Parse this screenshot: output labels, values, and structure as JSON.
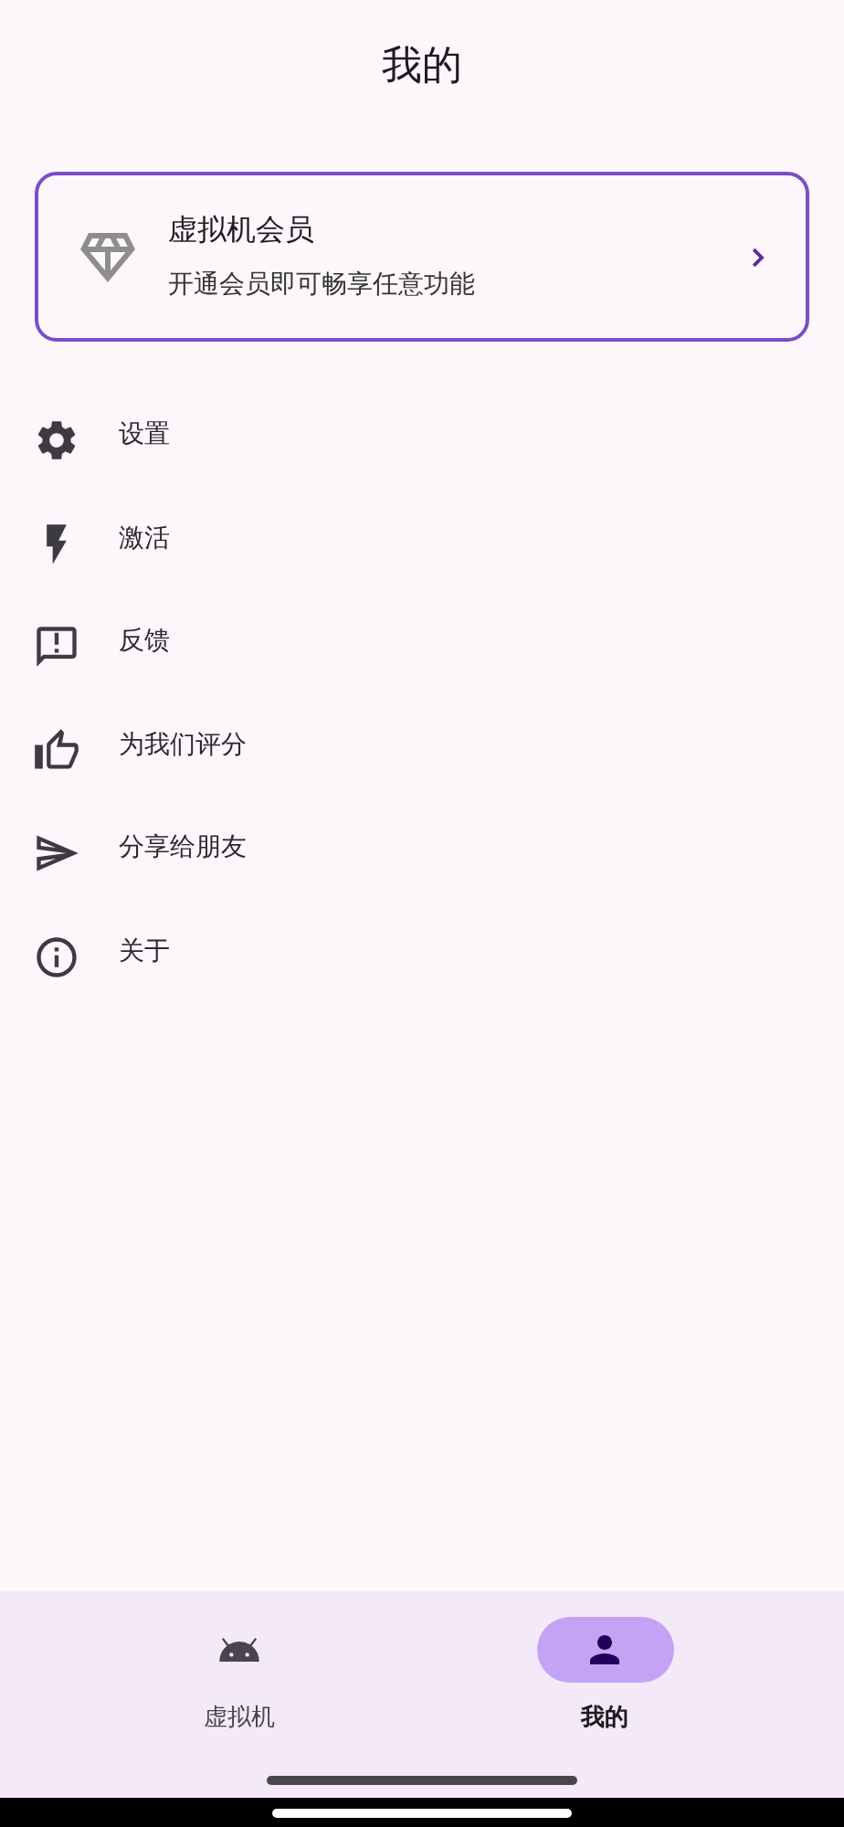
{
  "header": {
    "title": "我的"
  },
  "membership_card": {
    "title": "虚拟机会员",
    "subtitle": "开通会员即可畅享任意功能"
  },
  "menu": [
    {
      "kind": "settings",
      "label": "设置"
    },
    {
      "kind": "bolt",
      "label": "激活"
    },
    {
      "kind": "feedback",
      "label": "反馈"
    },
    {
      "kind": "thumb",
      "label": "为我们评分"
    },
    {
      "kind": "send",
      "label": "分享给朋友"
    },
    {
      "kind": "info",
      "label": "关于"
    }
  ],
  "bottom_nav": [
    {
      "kind": "android",
      "label": "虚拟机",
      "selected": false
    },
    {
      "kind": "person",
      "label": "我的",
      "selected": true
    }
  ]
}
